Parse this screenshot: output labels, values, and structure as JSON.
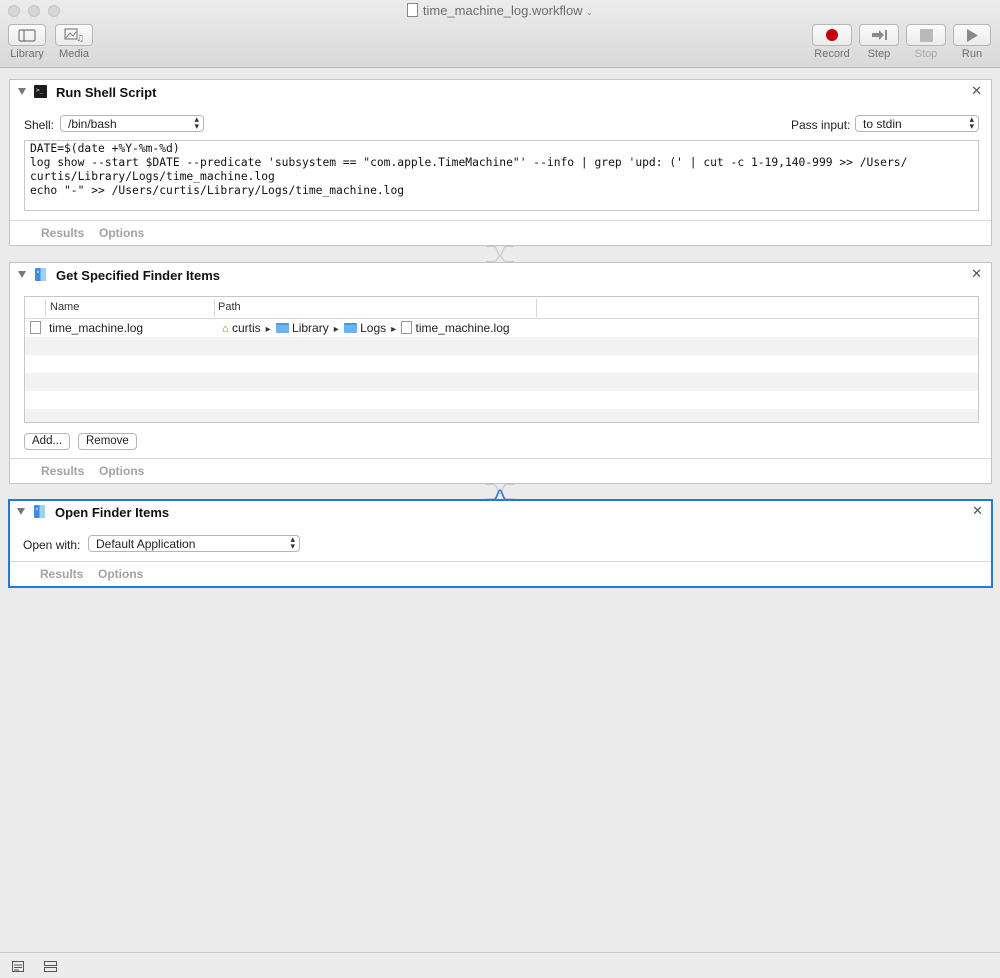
{
  "window": {
    "title": "time_machine_log.workflow"
  },
  "toolbar": {
    "library": "Library",
    "media": "Media",
    "record": "Record",
    "step": "Step",
    "stop": "Stop",
    "run": "Run"
  },
  "actions": [
    {
      "title": "Run Shell Script",
      "shell_label": "Shell:",
      "shell_value": "/bin/bash",
      "pass_input_label": "Pass input:",
      "pass_input_value": "to stdin",
      "script_lines": [
        "DATE=$(date +%Y-%m-%d)",
        "log show --start $DATE --predicate 'subsystem == \"com.apple.TimeMachine\"' --info | grep 'upd: (' | cut -c 1-19,140-999 >> /Users/",
        "curtis/Library/Logs/time_machine.log",
        "echo \"-\" >> /Users/curtis/Library/Logs/time_machine.log"
      ],
      "results": "Results",
      "options": "Options"
    },
    {
      "title": "Get Specified Finder Items",
      "columns": [
        "Name",
        "Path"
      ],
      "rows": [
        {
          "name": "time_machine.log",
          "path": [
            "curtis",
            "Library",
            "Logs",
            "time_machine.log"
          ]
        }
      ],
      "add_button": "Add...",
      "remove_button": "Remove",
      "results": "Results",
      "options": "Options"
    },
    {
      "title": "Open Finder Items",
      "open_with_label": "Open with:",
      "open_with_value": "Default Application",
      "results": "Results",
      "options": "Options"
    }
  ],
  "colors": {
    "selection_border": "#2a76d3",
    "record_red": "#c4000d",
    "folder_blue": "#6cb4ee"
  },
  "icons": {
    "library": "sidebar-icon",
    "media": "media-icon",
    "record": "record-icon",
    "step": "step-icon",
    "stop": "stop-icon",
    "run": "play-icon"
  }
}
